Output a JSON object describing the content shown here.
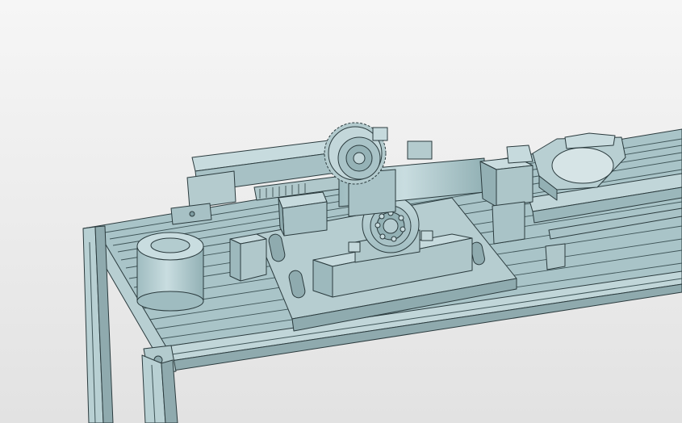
{
  "view": {
    "background_top": "#f6f6f6",
    "background_bottom": "#e2e2e2"
  },
  "model": {
    "part_fill": "#a9c4c8",
    "part_fill_light": "#c4d9dc",
    "part_fill_dark": "#7f9ea3",
    "edge_color": "#2b3b3e",
    "components": [
      "aluminum-profile-frame",
      "cylinder-block",
      "square-block-left",
      "base-plate",
      "pillow-block-bearing-front",
      "pillow-block-bearing-rear",
      "spur-gear",
      "gear-rack",
      "pneumatic-cylinder",
      "linear-guide-rail",
      "support-block-right",
      "ring-gripper"
    ]
  }
}
